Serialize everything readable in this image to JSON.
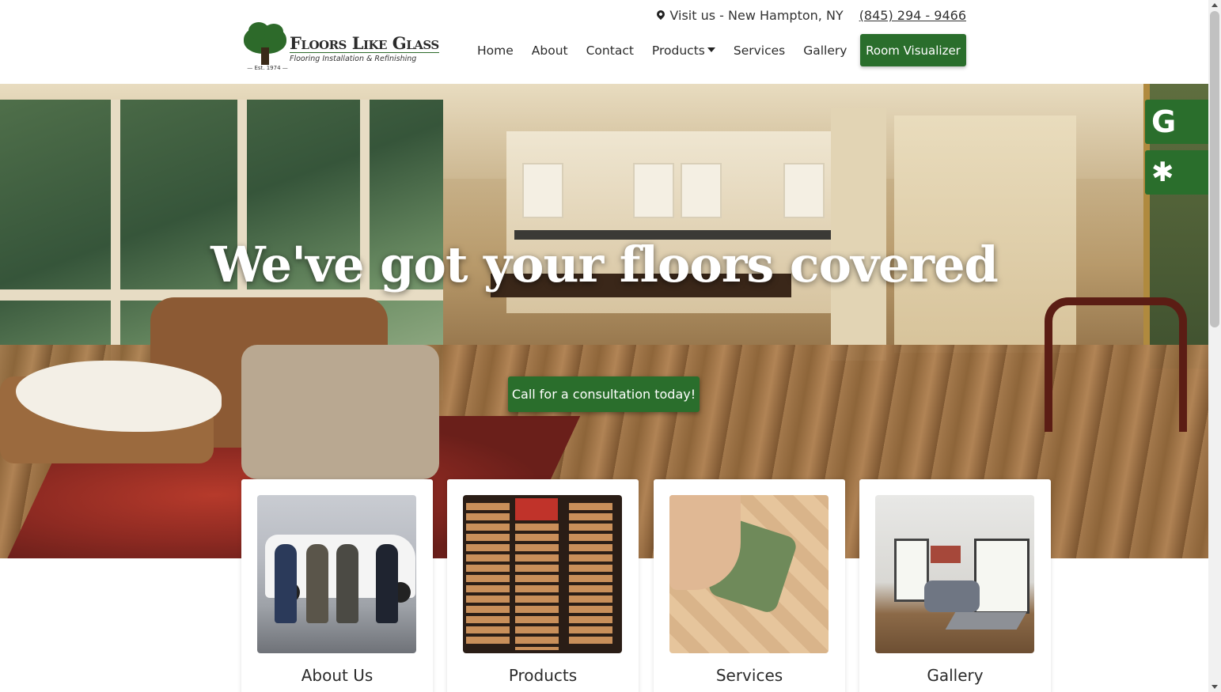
{
  "topbar": {
    "visit_label": "Visit us - New Hampton, NY",
    "phone": "(845) 294 - 9466"
  },
  "logo": {
    "brand": "Floors Like Glass",
    "tagline": "Flooring Installation & Refinishing",
    "est": "— Est. 1974 —"
  },
  "nav": {
    "items": [
      "Home",
      "About",
      "Contact",
      "Products",
      "Services",
      "Gallery"
    ],
    "cta": "Room Visualizer"
  },
  "hero": {
    "title": "We've got your floors covered",
    "cta": "Call for a consultation today!"
  },
  "badges": {
    "google": "G",
    "yelp": "✱"
  },
  "cards": [
    {
      "label": "About Us"
    },
    {
      "label": "Products"
    },
    {
      "label": "Services"
    },
    {
      "label": "Gallery"
    }
  ],
  "colors": {
    "brand_green": "#2a6e2c",
    "text_dark": "#2b2b2b"
  },
  "icons": [
    "location-pin-icon",
    "dropdown-caret-icon",
    "google-icon",
    "yelp-icon",
    "tree-logo-icon"
  ]
}
